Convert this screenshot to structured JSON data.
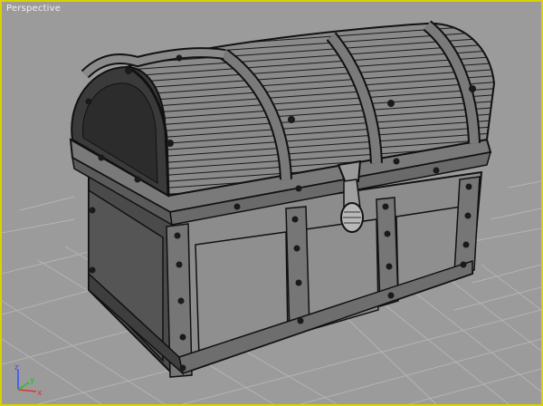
{
  "viewport": {
    "label": "Perspective",
    "border_color": "#d8d200",
    "background": "#9b9b9b"
  },
  "axis_gizmo": {
    "x_label": "x",
    "y_label": "y",
    "z_label": "z",
    "x_color": "#e03030",
    "y_color": "#20c020",
    "z_color": "#3050ff"
  }
}
